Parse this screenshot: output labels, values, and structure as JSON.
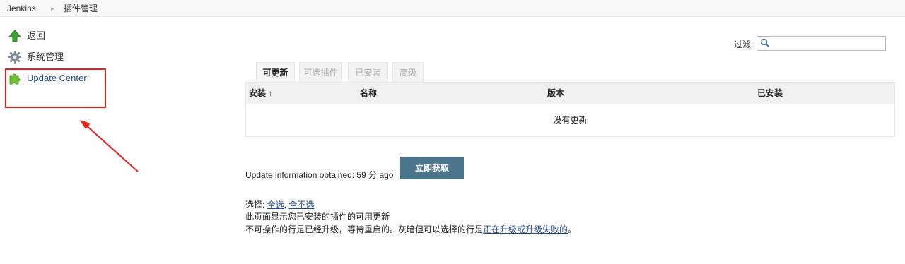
{
  "breadcrumb": {
    "items": [
      "Jenkins",
      "插件管理"
    ],
    "separator": "▸"
  },
  "sidebar": {
    "items": [
      {
        "label": "返回",
        "icon": "up-arrow-icon"
      },
      {
        "label": "系统管理",
        "icon": "gear-icon"
      },
      {
        "label": "Update Center",
        "icon": "puzzle-icon"
      }
    ]
  },
  "filter": {
    "label": "过滤:",
    "value": ""
  },
  "tabs": [
    {
      "label": "可更新",
      "active": true
    },
    {
      "label": "可选插件",
      "active": false
    },
    {
      "label": "已安装",
      "active": false
    },
    {
      "label": "高级",
      "active": false
    }
  ],
  "table": {
    "columns": [
      "安装",
      "名称",
      "版本",
      "已安装"
    ],
    "sort_indicator": "↑",
    "empty_message": "没有更新"
  },
  "update": {
    "info_text": "Update information obtained: 59 分 ago",
    "fetch_button": "立即获取"
  },
  "selection": {
    "prefix": "选择:",
    "select_all": "全选",
    "separator": ",",
    "select_none": "全不选"
  },
  "notes": {
    "line1": "此页面显示您已安装的插件的可用更新",
    "line2_prefix": "不可操作的行是已经升级，等待重启的。灰暗但可以选择的行是",
    "line2_link": "正在升级或升级失败的",
    "line2_suffix": "。"
  },
  "colors": {
    "link": "#204a87",
    "button": "#4b758b",
    "annotation": "#e8201a"
  }
}
